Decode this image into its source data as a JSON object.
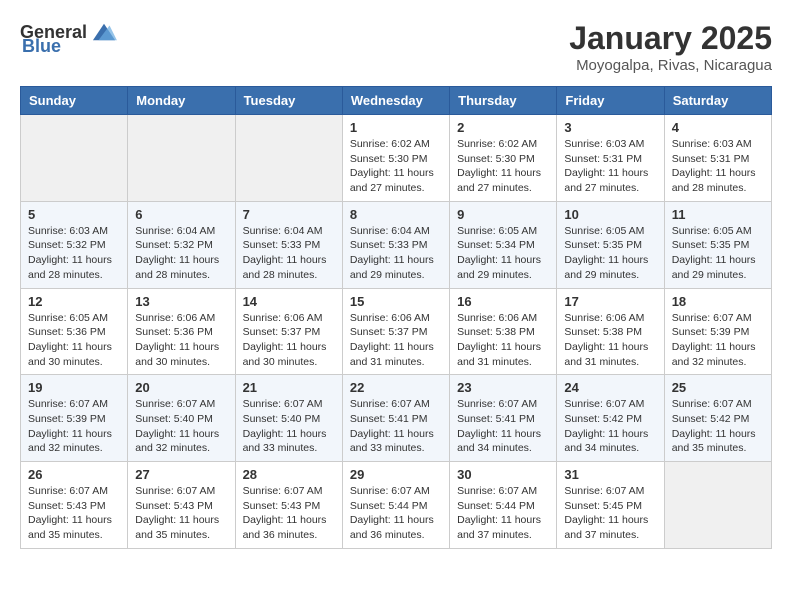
{
  "header": {
    "logo_general": "General",
    "logo_blue": "Blue",
    "month_title": "January 2025",
    "location": "Moyogalpa, Rivas, Nicaragua"
  },
  "weekdays": [
    "Sunday",
    "Monday",
    "Tuesday",
    "Wednesday",
    "Thursday",
    "Friday",
    "Saturday"
  ],
  "weeks": [
    [
      {
        "day": "",
        "sunrise": "",
        "sunset": "",
        "daylight": ""
      },
      {
        "day": "",
        "sunrise": "",
        "sunset": "",
        "daylight": ""
      },
      {
        "day": "",
        "sunrise": "",
        "sunset": "",
        "daylight": ""
      },
      {
        "day": "1",
        "sunrise": "Sunrise: 6:02 AM",
        "sunset": "Sunset: 5:30 PM",
        "daylight": "Daylight: 11 hours and 27 minutes."
      },
      {
        "day": "2",
        "sunrise": "Sunrise: 6:02 AM",
        "sunset": "Sunset: 5:30 PM",
        "daylight": "Daylight: 11 hours and 27 minutes."
      },
      {
        "day": "3",
        "sunrise": "Sunrise: 6:03 AM",
        "sunset": "Sunset: 5:31 PM",
        "daylight": "Daylight: 11 hours and 27 minutes."
      },
      {
        "day": "4",
        "sunrise": "Sunrise: 6:03 AM",
        "sunset": "Sunset: 5:31 PM",
        "daylight": "Daylight: 11 hours and 28 minutes."
      }
    ],
    [
      {
        "day": "5",
        "sunrise": "Sunrise: 6:03 AM",
        "sunset": "Sunset: 5:32 PM",
        "daylight": "Daylight: 11 hours and 28 minutes."
      },
      {
        "day": "6",
        "sunrise": "Sunrise: 6:04 AM",
        "sunset": "Sunset: 5:32 PM",
        "daylight": "Daylight: 11 hours and 28 minutes."
      },
      {
        "day": "7",
        "sunrise": "Sunrise: 6:04 AM",
        "sunset": "Sunset: 5:33 PM",
        "daylight": "Daylight: 11 hours and 28 minutes."
      },
      {
        "day": "8",
        "sunrise": "Sunrise: 6:04 AM",
        "sunset": "Sunset: 5:33 PM",
        "daylight": "Daylight: 11 hours and 29 minutes."
      },
      {
        "day": "9",
        "sunrise": "Sunrise: 6:05 AM",
        "sunset": "Sunset: 5:34 PM",
        "daylight": "Daylight: 11 hours and 29 minutes."
      },
      {
        "day": "10",
        "sunrise": "Sunrise: 6:05 AM",
        "sunset": "Sunset: 5:35 PM",
        "daylight": "Daylight: 11 hours and 29 minutes."
      },
      {
        "day": "11",
        "sunrise": "Sunrise: 6:05 AM",
        "sunset": "Sunset: 5:35 PM",
        "daylight": "Daylight: 11 hours and 29 minutes."
      }
    ],
    [
      {
        "day": "12",
        "sunrise": "Sunrise: 6:05 AM",
        "sunset": "Sunset: 5:36 PM",
        "daylight": "Daylight: 11 hours and 30 minutes."
      },
      {
        "day": "13",
        "sunrise": "Sunrise: 6:06 AM",
        "sunset": "Sunset: 5:36 PM",
        "daylight": "Daylight: 11 hours and 30 minutes."
      },
      {
        "day": "14",
        "sunrise": "Sunrise: 6:06 AM",
        "sunset": "Sunset: 5:37 PM",
        "daylight": "Daylight: 11 hours and 30 minutes."
      },
      {
        "day": "15",
        "sunrise": "Sunrise: 6:06 AM",
        "sunset": "Sunset: 5:37 PM",
        "daylight": "Daylight: 11 hours and 31 minutes."
      },
      {
        "day": "16",
        "sunrise": "Sunrise: 6:06 AM",
        "sunset": "Sunset: 5:38 PM",
        "daylight": "Daylight: 11 hours and 31 minutes."
      },
      {
        "day": "17",
        "sunrise": "Sunrise: 6:06 AM",
        "sunset": "Sunset: 5:38 PM",
        "daylight": "Daylight: 11 hours and 31 minutes."
      },
      {
        "day": "18",
        "sunrise": "Sunrise: 6:07 AM",
        "sunset": "Sunset: 5:39 PM",
        "daylight": "Daylight: 11 hours and 32 minutes."
      }
    ],
    [
      {
        "day": "19",
        "sunrise": "Sunrise: 6:07 AM",
        "sunset": "Sunset: 5:39 PM",
        "daylight": "Daylight: 11 hours and 32 minutes."
      },
      {
        "day": "20",
        "sunrise": "Sunrise: 6:07 AM",
        "sunset": "Sunset: 5:40 PM",
        "daylight": "Daylight: 11 hours and 32 minutes."
      },
      {
        "day": "21",
        "sunrise": "Sunrise: 6:07 AM",
        "sunset": "Sunset: 5:40 PM",
        "daylight": "Daylight: 11 hours and 33 minutes."
      },
      {
        "day": "22",
        "sunrise": "Sunrise: 6:07 AM",
        "sunset": "Sunset: 5:41 PM",
        "daylight": "Daylight: 11 hours and 33 minutes."
      },
      {
        "day": "23",
        "sunrise": "Sunrise: 6:07 AM",
        "sunset": "Sunset: 5:41 PM",
        "daylight": "Daylight: 11 hours and 34 minutes."
      },
      {
        "day": "24",
        "sunrise": "Sunrise: 6:07 AM",
        "sunset": "Sunset: 5:42 PM",
        "daylight": "Daylight: 11 hours and 34 minutes."
      },
      {
        "day": "25",
        "sunrise": "Sunrise: 6:07 AM",
        "sunset": "Sunset: 5:42 PM",
        "daylight": "Daylight: 11 hours and 35 minutes."
      }
    ],
    [
      {
        "day": "26",
        "sunrise": "Sunrise: 6:07 AM",
        "sunset": "Sunset: 5:43 PM",
        "daylight": "Daylight: 11 hours and 35 minutes."
      },
      {
        "day": "27",
        "sunrise": "Sunrise: 6:07 AM",
        "sunset": "Sunset: 5:43 PM",
        "daylight": "Daylight: 11 hours and 35 minutes."
      },
      {
        "day": "28",
        "sunrise": "Sunrise: 6:07 AM",
        "sunset": "Sunset: 5:43 PM",
        "daylight": "Daylight: 11 hours and 36 minutes."
      },
      {
        "day": "29",
        "sunrise": "Sunrise: 6:07 AM",
        "sunset": "Sunset: 5:44 PM",
        "daylight": "Daylight: 11 hours and 36 minutes."
      },
      {
        "day": "30",
        "sunrise": "Sunrise: 6:07 AM",
        "sunset": "Sunset: 5:44 PM",
        "daylight": "Daylight: 11 hours and 37 minutes."
      },
      {
        "day": "31",
        "sunrise": "Sunrise: 6:07 AM",
        "sunset": "Sunset: 5:45 PM",
        "daylight": "Daylight: 11 hours and 37 minutes."
      },
      {
        "day": "",
        "sunrise": "",
        "sunset": "",
        "daylight": ""
      }
    ]
  ]
}
